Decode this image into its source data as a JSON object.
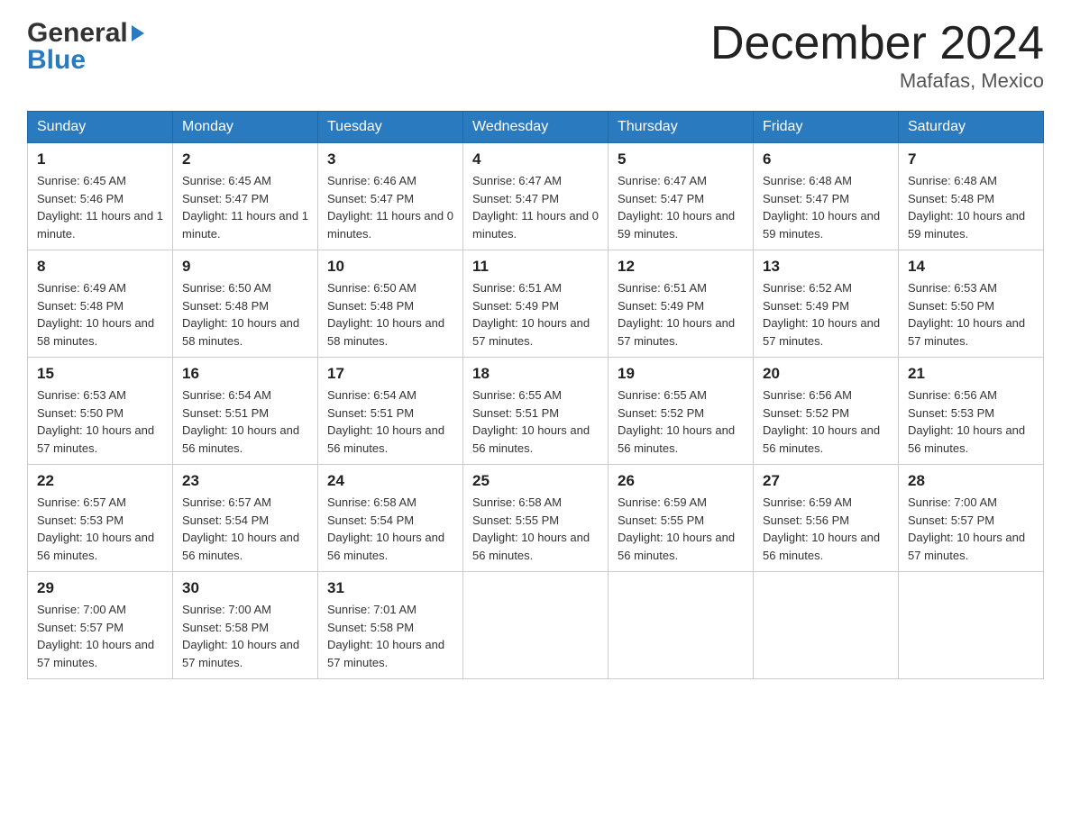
{
  "logo": {
    "general": "General",
    "blue": "Blue"
  },
  "title": "December 2024",
  "subtitle": "Mafafas, Mexico",
  "days_of_week": [
    "Sunday",
    "Monday",
    "Tuesday",
    "Wednesday",
    "Thursday",
    "Friday",
    "Saturday"
  ],
  "weeks": [
    [
      {
        "day": "1",
        "sunrise": "6:45 AM",
        "sunset": "5:46 PM",
        "daylight": "11 hours and 1 minute."
      },
      {
        "day": "2",
        "sunrise": "6:45 AM",
        "sunset": "5:47 PM",
        "daylight": "11 hours and 1 minute."
      },
      {
        "day": "3",
        "sunrise": "6:46 AM",
        "sunset": "5:47 PM",
        "daylight": "11 hours and 0 minutes."
      },
      {
        "day": "4",
        "sunrise": "6:47 AM",
        "sunset": "5:47 PM",
        "daylight": "11 hours and 0 minutes."
      },
      {
        "day": "5",
        "sunrise": "6:47 AM",
        "sunset": "5:47 PM",
        "daylight": "10 hours and 59 minutes."
      },
      {
        "day": "6",
        "sunrise": "6:48 AM",
        "sunset": "5:47 PM",
        "daylight": "10 hours and 59 minutes."
      },
      {
        "day": "7",
        "sunrise": "6:48 AM",
        "sunset": "5:48 PM",
        "daylight": "10 hours and 59 minutes."
      }
    ],
    [
      {
        "day": "8",
        "sunrise": "6:49 AM",
        "sunset": "5:48 PM",
        "daylight": "10 hours and 58 minutes."
      },
      {
        "day": "9",
        "sunrise": "6:50 AM",
        "sunset": "5:48 PM",
        "daylight": "10 hours and 58 minutes."
      },
      {
        "day": "10",
        "sunrise": "6:50 AM",
        "sunset": "5:48 PM",
        "daylight": "10 hours and 58 minutes."
      },
      {
        "day": "11",
        "sunrise": "6:51 AM",
        "sunset": "5:49 PM",
        "daylight": "10 hours and 57 minutes."
      },
      {
        "day": "12",
        "sunrise": "6:51 AM",
        "sunset": "5:49 PM",
        "daylight": "10 hours and 57 minutes."
      },
      {
        "day": "13",
        "sunrise": "6:52 AM",
        "sunset": "5:49 PM",
        "daylight": "10 hours and 57 minutes."
      },
      {
        "day": "14",
        "sunrise": "6:53 AM",
        "sunset": "5:50 PM",
        "daylight": "10 hours and 57 minutes."
      }
    ],
    [
      {
        "day": "15",
        "sunrise": "6:53 AM",
        "sunset": "5:50 PM",
        "daylight": "10 hours and 57 minutes."
      },
      {
        "day": "16",
        "sunrise": "6:54 AM",
        "sunset": "5:51 PM",
        "daylight": "10 hours and 56 minutes."
      },
      {
        "day": "17",
        "sunrise": "6:54 AM",
        "sunset": "5:51 PM",
        "daylight": "10 hours and 56 minutes."
      },
      {
        "day": "18",
        "sunrise": "6:55 AM",
        "sunset": "5:51 PM",
        "daylight": "10 hours and 56 minutes."
      },
      {
        "day": "19",
        "sunrise": "6:55 AM",
        "sunset": "5:52 PM",
        "daylight": "10 hours and 56 minutes."
      },
      {
        "day": "20",
        "sunrise": "6:56 AM",
        "sunset": "5:52 PM",
        "daylight": "10 hours and 56 minutes."
      },
      {
        "day": "21",
        "sunrise": "6:56 AM",
        "sunset": "5:53 PM",
        "daylight": "10 hours and 56 minutes."
      }
    ],
    [
      {
        "day": "22",
        "sunrise": "6:57 AM",
        "sunset": "5:53 PM",
        "daylight": "10 hours and 56 minutes."
      },
      {
        "day": "23",
        "sunrise": "6:57 AM",
        "sunset": "5:54 PM",
        "daylight": "10 hours and 56 minutes."
      },
      {
        "day": "24",
        "sunrise": "6:58 AM",
        "sunset": "5:54 PM",
        "daylight": "10 hours and 56 minutes."
      },
      {
        "day": "25",
        "sunrise": "6:58 AM",
        "sunset": "5:55 PM",
        "daylight": "10 hours and 56 minutes."
      },
      {
        "day": "26",
        "sunrise": "6:59 AM",
        "sunset": "5:55 PM",
        "daylight": "10 hours and 56 minutes."
      },
      {
        "day": "27",
        "sunrise": "6:59 AM",
        "sunset": "5:56 PM",
        "daylight": "10 hours and 56 minutes."
      },
      {
        "day": "28",
        "sunrise": "7:00 AM",
        "sunset": "5:57 PM",
        "daylight": "10 hours and 57 minutes."
      }
    ],
    [
      {
        "day": "29",
        "sunrise": "7:00 AM",
        "sunset": "5:57 PM",
        "daylight": "10 hours and 57 minutes."
      },
      {
        "day": "30",
        "sunrise": "7:00 AM",
        "sunset": "5:58 PM",
        "daylight": "10 hours and 57 minutes."
      },
      {
        "day": "31",
        "sunrise": "7:01 AM",
        "sunset": "5:58 PM",
        "daylight": "10 hours and 57 minutes."
      },
      null,
      null,
      null,
      null
    ]
  ]
}
